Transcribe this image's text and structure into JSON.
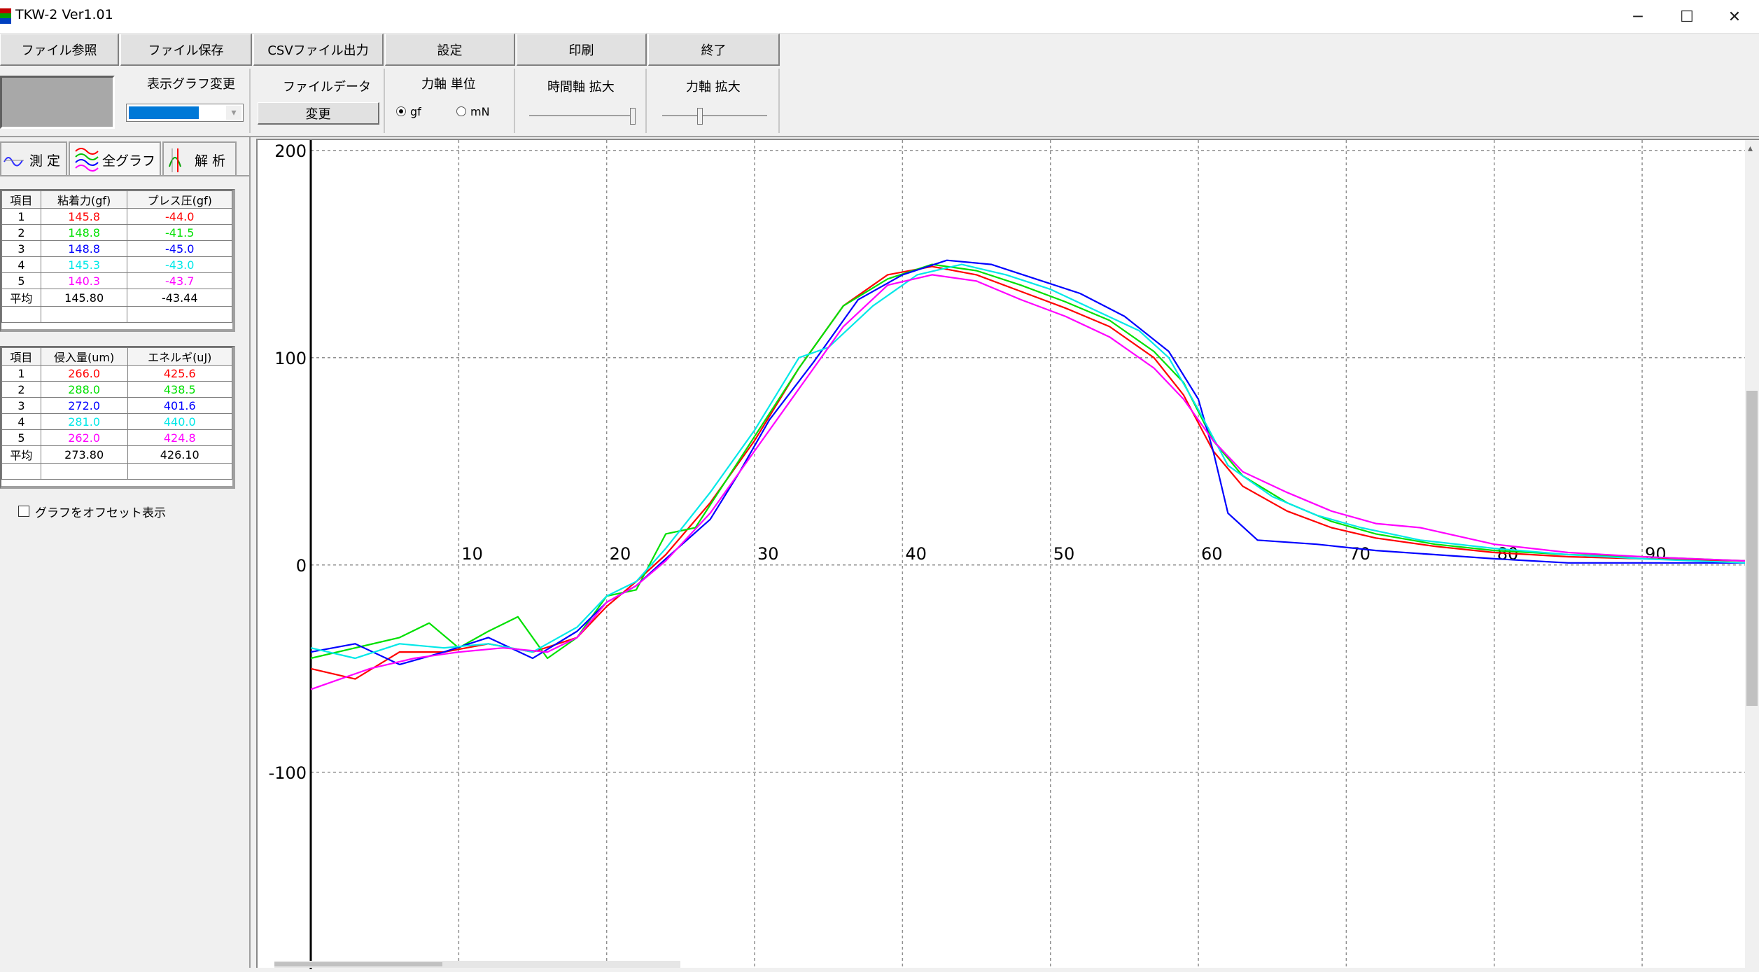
{
  "window": {
    "title": "TKW-2 Ver1.01",
    "minimize_glyph": "─",
    "maximize_glyph": "☐",
    "close_glyph": "✕",
    "icon": "app-icon"
  },
  "toolbar": {
    "file_browse": "ファイル参照",
    "file_save": "ファイル保存",
    "csv_export": "CSVファイル出力",
    "settings": "設定",
    "print": "印刷",
    "exit": "終了"
  },
  "controls": {
    "graph_change_label": "表示グラフ変更",
    "graph_select_value": "",
    "file_data_label": "ファイルデータ",
    "change_button": "変更",
    "force_unit_label": "力軸 単位",
    "unit_gf": "gf",
    "unit_mn": "mN",
    "unit_selected": "gf",
    "time_zoom_label": "時間軸 拡大",
    "time_zoom_level": 1.0,
    "force_zoom_label": "力軸 拡大",
    "force_zoom_level": 0.35
  },
  "tabs": [
    {
      "label": "測 定",
      "icon": "wave-icon"
    },
    {
      "label": "全グラフ",
      "icon": "multi-wave-icon"
    },
    {
      "label": "解 析",
      "icon": "analysis-icon"
    }
  ],
  "table1": {
    "headers": [
      "項目",
      "粘着力(gf)",
      "プレス圧(gf)"
    ],
    "rows": [
      {
        "item": "1",
        "a": "145.8",
        "b": "-44.0",
        "color": "#ff0000"
      },
      {
        "item": "2",
        "a": "148.8",
        "b": "-41.5",
        "color": "#00e000"
      },
      {
        "item": "3",
        "a": "148.8",
        "b": "-45.0",
        "color": "#0000ff"
      },
      {
        "item": "4",
        "a": "145.3",
        "b": "-43.0",
        "color": "#00e8e8"
      },
      {
        "item": "5",
        "a": "140.3",
        "b": "-43.7",
        "color": "#ff00ff"
      },
      {
        "item": "平均",
        "a": "145.80",
        "b": "-43.44",
        "color": "#000000"
      }
    ]
  },
  "table2": {
    "headers": [
      "項目",
      "侵入量(um)",
      "エネルギ(uJ)"
    ],
    "rows": [
      {
        "item": "1",
        "a": "266.0",
        "b": "425.6",
        "color": "#ff0000"
      },
      {
        "item": "2",
        "a": "288.0",
        "b": "438.5",
        "color": "#00e000"
      },
      {
        "item": "3",
        "a": "272.0",
        "b": "401.6",
        "color": "#0000ff"
      },
      {
        "item": "4",
        "a": "281.0",
        "b": "440.0",
        "color": "#00e8e8"
      },
      {
        "item": "5",
        "a": "262.0",
        "b": "424.8",
        "color": "#ff00ff"
      },
      {
        "item": "平均",
        "a": "273.80",
        "b": "426.10",
        "color": "#000000"
      }
    ]
  },
  "offset_checkbox": {
    "label": "グラフをオフセット表示",
    "checked": false
  },
  "chart_data": {
    "type": "line",
    "xlim": [
      0,
      97
    ],
    "ylim": [
      -195,
      205
    ],
    "x_ticks": [
      10,
      20,
      30,
      40,
      50,
      60,
      70,
      80,
      90
    ],
    "y_ticks": [
      200,
      100,
      0,
      -100
    ],
    "grid": true,
    "series": [
      {
        "color": "#ff0000",
        "points": [
          [
            0,
            -50
          ],
          [
            3,
            -55
          ],
          [
            6,
            -42
          ],
          [
            9,
            -42
          ],
          [
            12,
            -38
          ],
          [
            15,
            -42
          ],
          [
            18,
            -35
          ],
          [
            20,
            -20
          ],
          [
            22,
            -8
          ],
          [
            24,
            5
          ],
          [
            27,
            30
          ],
          [
            30,
            60
          ],
          [
            33,
            95
          ],
          [
            36,
            125
          ],
          [
            39,
            140
          ],
          [
            42,
            144
          ],
          [
            45,
            140
          ],
          [
            48,
            132
          ],
          [
            51,
            124
          ],
          [
            54,
            115
          ],
          [
            57,
            100
          ],
          [
            59,
            82
          ],
          [
            61,
            55
          ],
          [
            63,
            38
          ],
          [
            66,
            26
          ],
          [
            69,
            18
          ],
          [
            72,
            13
          ],
          [
            76,
            9
          ],
          [
            80,
            6
          ],
          [
            85,
            4
          ],
          [
            90,
            3
          ],
          [
            97,
            2
          ]
        ]
      },
      {
        "color": "#00e000",
        "points": [
          [
            0,
            -45
          ],
          [
            3,
            -40
          ],
          [
            6,
            -35
          ],
          [
            8,
            -28
          ],
          [
            10,
            -40
          ],
          [
            12,
            -32
          ],
          [
            14,
            -25
          ],
          [
            16,
            -45
          ],
          [
            18,
            -35
          ],
          [
            20,
            -15
          ],
          [
            22,
            -12
          ],
          [
            24,
            15
          ],
          [
            26,
            18
          ],
          [
            28,
            40
          ],
          [
            30,
            62
          ],
          [
            33,
            95
          ],
          [
            36,
            125
          ],
          [
            39,
            138
          ],
          [
            42,
            145
          ],
          [
            45,
            142
          ],
          [
            48,
            135
          ],
          [
            51,
            127
          ],
          [
            54,
            118
          ],
          [
            57,
            103
          ],
          [
            59,
            88
          ],
          [
            61,
            60
          ],
          [
            63,
            43
          ],
          [
            66,
            30
          ],
          [
            69,
            21
          ],
          [
            72,
            15
          ],
          [
            76,
            10
          ],
          [
            80,
            7
          ],
          [
            85,
            5
          ],
          [
            90,
            4
          ],
          [
            97,
            2
          ]
        ]
      },
      {
        "color": "#0000ff",
        "points": [
          [
            0,
            -42
          ],
          [
            3,
            -38
          ],
          [
            6,
            -48
          ],
          [
            9,
            -42
          ],
          [
            12,
            -35
          ],
          [
            15,
            -45
          ],
          [
            18,
            -32
          ],
          [
            20,
            -18
          ],
          [
            22,
            -10
          ],
          [
            24,
            3
          ],
          [
            27,
            22
          ],
          [
            29,
            45
          ],
          [
            31,
            70
          ],
          [
            34,
            98
          ],
          [
            37,
            128
          ],
          [
            40,
            140
          ],
          [
            43,
            147
          ],
          [
            46,
            145
          ],
          [
            49,
            138
          ],
          [
            52,
            131
          ],
          [
            55,
            120
          ],
          [
            58,
            103
          ],
          [
            60,
            80
          ],
          [
            61,
            55
          ],
          [
            62,
            25
          ],
          [
            64,
            12
          ],
          [
            68,
            10
          ],
          [
            72,
            7
          ],
          [
            76,
            5
          ],
          [
            80,
            3
          ],
          [
            85,
            1
          ],
          [
            90,
            1
          ],
          [
            97,
            1
          ]
        ]
      },
      {
        "color": "#00e8e8",
        "points": [
          [
            0,
            -40
          ],
          [
            3,
            -45
          ],
          [
            6,
            -38
          ],
          [
            9,
            -40
          ],
          [
            12,
            -38
          ],
          [
            15,
            -42
          ],
          [
            18,
            -30
          ],
          [
            20,
            -15
          ],
          [
            22,
            -8
          ],
          [
            24,
            8
          ],
          [
            27,
            35
          ],
          [
            30,
            65
          ],
          [
            33,
            100
          ],
          [
            35,
            105
          ],
          [
            38,
            125
          ],
          [
            41,
            140
          ],
          [
            44,
            145
          ],
          [
            47,
            140
          ],
          [
            50,
            133
          ],
          [
            53,
            123
          ],
          [
            56,
            113
          ],
          [
            58,
            100
          ],
          [
            60,
            75
          ],
          [
            62,
            48
          ],
          [
            65,
            33
          ],
          [
            68,
            24
          ],
          [
            71,
            18
          ],
          [
            75,
            12
          ],
          [
            80,
            8
          ],
          [
            85,
            5
          ],
          [
            90,
            3
          ],
          [
            97,
            1
          ]
        ]
      },
      {
        "color": "#ff00ff",
        "points": [
          [
            0,
            -60
          ],
          [
            2,
            -55
          ],
          [
            4,
            -50
          ],
          [
            7,
            -45
          ],
          [
            10,
            -42
          ],
          [
            13,
            -40
          ],
          [
            16,
            -42
          ],
          [
            18,
            -35
          ],
          [
            20,
            -18
          ],
          [
            22,
            -10
          ],
          [
            24,
            2
          ],
          [
            27,
            25
          ],
          [
            30,
            55
          ],
          [
            33,
            85
          ],
          [
            36,
            115
          ],
          [
            39,
            135
          ],
          [
            42,
            140
          ],
          [
            45,
            137
          ],
          [
            48,
            128
          ],
          [
            51,
            120
          ],
          [
            54,
            110
          ],
          [
            57,
            95
          ],
          [
            59,
            80
          ],
          [
            61,
            60
          ],
          [
            63,
            45
          ],
          [
            66,
            35
          ],
          [
            69,
            26
          ],
          [
            72,
            20
          ],
          [
            75,
            18
          ],
          [
            80,
            10
          ],
          [
            85,
            6
          ],
          [
            90,
            4
          ],
          [
            97,
            2
          ]
        ]
      }
    ]
  }
}
